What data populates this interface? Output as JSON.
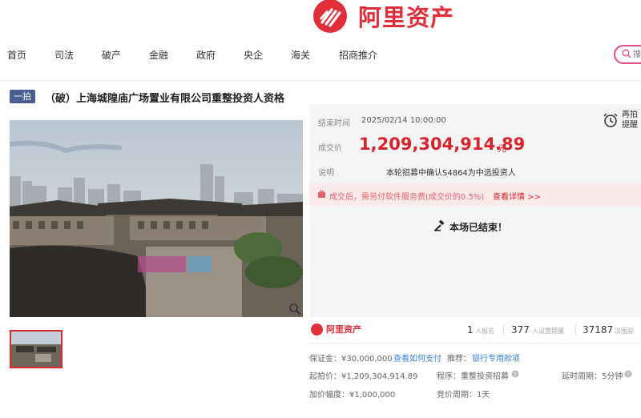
{
  "brand": {
    "name": "阿里资产"
  },
  "nav": {
    "items": [
      "首页",
      "司法",
      "破产",
      "金融",
      "政府",
      "央企",
      "海关",
      "招商推介"
    ],
    "search_placeholder": "搜"
  },
  "auction": {
    "badge": "一拍",
    "title": "（破）上海城隍庙广场置业有限公司重整投资人资格",
    "end_time_label": "结束时间",
    "end_time": "2025/02/14 10:00:00",
    "price_label": "成交价",
    "price": "1,209,304,914.89",
    "price_unit": "元",
    "note_label": "说明",
    "note": "本轮招募中确认S4864为中选投资人",
    "remind_label": "再拍提醒",
    "fee_notice": "成交后，需另付软件服务费(成交价的0.5%)",
    "fee_link": "查看详情 >>",
    "status": "本场已结束！"
  },
  "stats": {
    "logo": "阿里资产",
    "signup_count": "1",
    "signup_label": "人报名",
    "remind_count": "377",
    "remind_label": "人设置提醒",
    "view_count": "37187",
    "view_label": "次围观"
  },
  "details": {
    "deposit": "保证金：¥30,000,000",
    "deposit_link": "查看如何支付",
    "recommend": "推荐：",
    "recommend_link": "银行专用款项",
    "start_price": "起拍价：¥1,209,304,914.89",
    "procedure": "程序：重整投资招募",
    "delay": "延时周期：5分钟",
    "increment": "加价幅度：¥1,000,000",
    "bid_cycle": "竞价周期：1天"
  },
  "colors": {
    "brand_red": "#e02e3a",
    "price_red": "#d8232a",
    "link_blue": "#3d7fd6",
    "badge_blue": "#4a5f8f",
    "search_pink": "#e84a84"
  }
}
